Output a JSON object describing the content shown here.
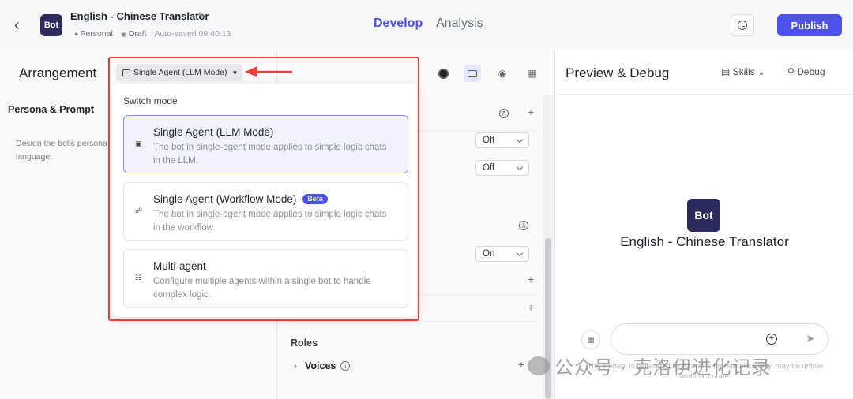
{
  "header": {
    "back_icon": "chevron-left-icon",
    "bot_logo": "Bot",
    "bot_title": "English - Chinese Translator",
    "edit_icon": "edit-icon",
    "owner": "Personal",
    "status": "Draft",
    "autosaved": "Auto-saved 09:40:13",
    "tabs": [
      {
        "label": "Develop",
        "active": true
      },
      {
        "label": "Analysis",
        "active": false
      }
    ],
    "history_icon": "clock-icon",
    "publish_label": "Publish",
    "accent_color": "#4d53e8"
  },
  "left": {
    "title": "Arrangement",
    "mode_selected": "Single Agent (LLM Mode)",
    "persona_title": "Persona & Prompt",
    "persona_desc": "Design the bot's persona, language."
  },
  "dropdown": {
    "title": "Switch mode",
    "options": [
      {
        "name": "Single Agent (LLM Mode)",
        "desc": "The bot in single-agent mode applies to simple logic chats in the LLM.",
        "selected": true,
        "badge": ""
      },
      {
        "name": "Single Agent (Workflow Mode)",
        "desc": "The bot in single-agent mode applies to simple logic chats in the workflow.",
        "selected": false,
        "badge": "Beta"
      },
      {
        "name": "Multi-agent",
        "desc": "Configure multiple agents within a single bot to handle complex logic.",
        "selected": false,
        "badge": ""
      }
    ]
  },
  "middle": {
    "selects": [
      "Off",
      "Off",
      "On"
    ],
    "roles": "Roles",
    "voices": "Voices"
  },
  "right": {
    "title": "Preview & Debug",
    "skills": "Skills",
    "debug": "Debug",
    "bot_avatar": "Bot",
    "bot_name": "English - Chinese Translator",
    "input_placeholder": "",
    "disclaimer": "The content is generated by AI and is for reference only, may be untrue and inaccurate."
  },
  "watermark": "公众号 · 克洛伊进化记录"
}
